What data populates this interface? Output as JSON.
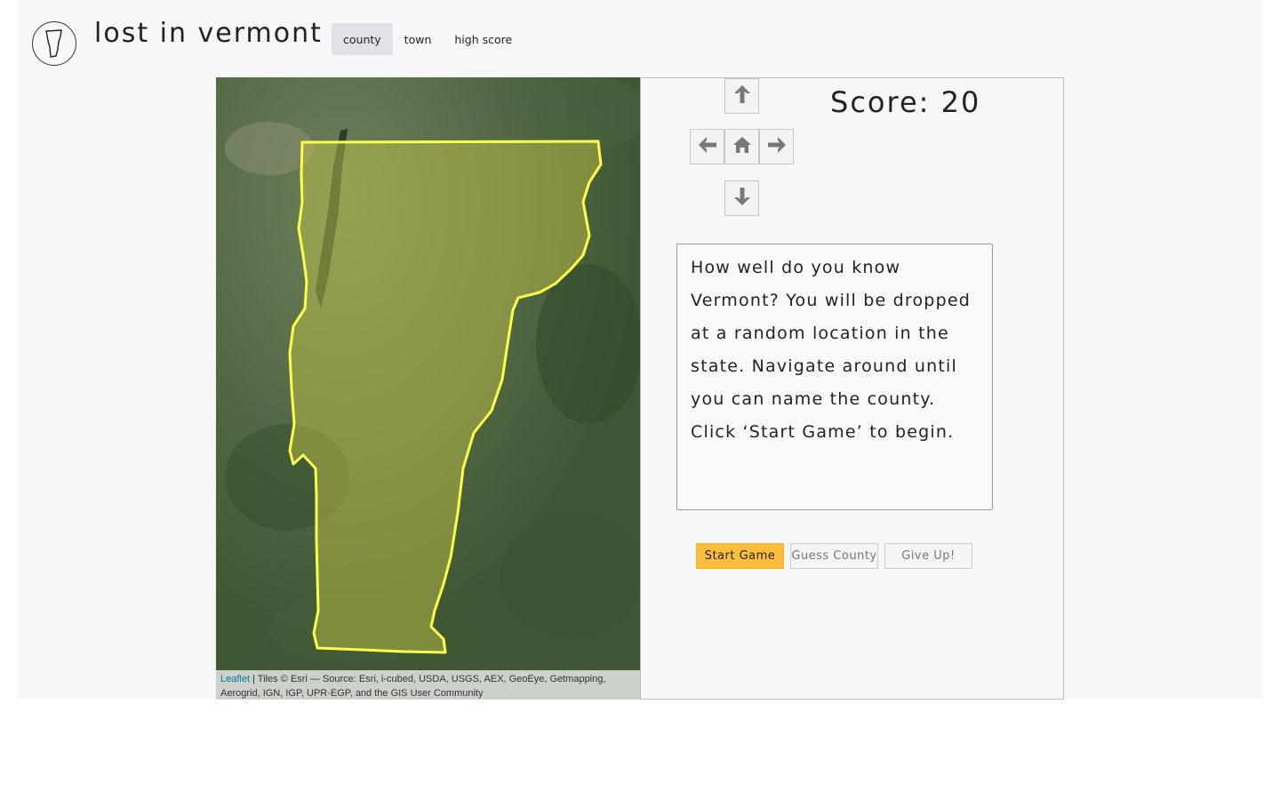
{
  "header": {
    "title": "lost in vermont",
    "nav": [
      {
        "label": "county",
        "active": true
      },
      {
        "label": "town",
        "active": false
      },
      {
        "label": "high score",
        "active": false
      }
    ]
  },
  "map": {
    "attribution_link": "Leaflet",
    "attribution_text": " | Tiles © Esri — Source: Esri, i-cubed, USDA, USGS, AEX, GeoEye, Getmapping, Aerogrid, IGN, IGP, UPR-EGP, and the GIS User Community",
    "boundary_color": "#ffff4a"
  },
  "score": {
    "label": "Score: 20"
  },
  "direction_pad": {
    "up": "arrow-up-icon",
    "left": "arrow-left-icon",
    "home": "home-icon",
    "right": "arrow-right-icon",
    "down": "arrow-down-icon"
  },
  "instructions": "How well do you know Vermont? You will be dropped at a random location in the state. Navigate around until you can name the county. Click ‘Start Game’ to begin.",
  "buttons": {
    "start": "Start Game",
    "guess": "Guess County",
    "give_up": "Give Up!"
  },
  "colors": {
    "accent": "#fbbd3a",
    "panel_bg": "#f6f7f8"
  }
}
